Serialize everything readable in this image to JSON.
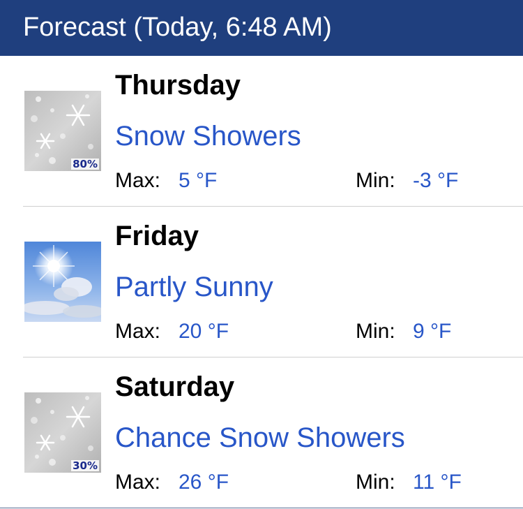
{
  "header": {
    "title": "Forecast (Today, 6:48 AM)"
  },
  "labels": {
    "max": "Max:",
    "min": "Min:"
  },
  "colors": {
    "header_bg": "#1f3f7e",
    "accent": "#2856c8"
  },
  "forecast": [
    {
      "day": "Thursday",
      "condition": "Snow Showers",
      "max": "5 °F",
      "min": "-3 °F",
      "icon": "snow-showers-icon",
      "precip": "80%"
    },
    {
      "day": "Friday",
      "condition": "Partly Sunny",
      "max": "20 °F",
      "min": "9 °F",
      "icon": "partly-sunny-icon"
    },
    {
      "day": "Saturday",
      "condition": "Chance Snow Showers",
      "max": "26 °F",
      "min": "11 °F",
      "icon": "snow-showers-icon",
      "precip": "30%"
    }
  ]
}
